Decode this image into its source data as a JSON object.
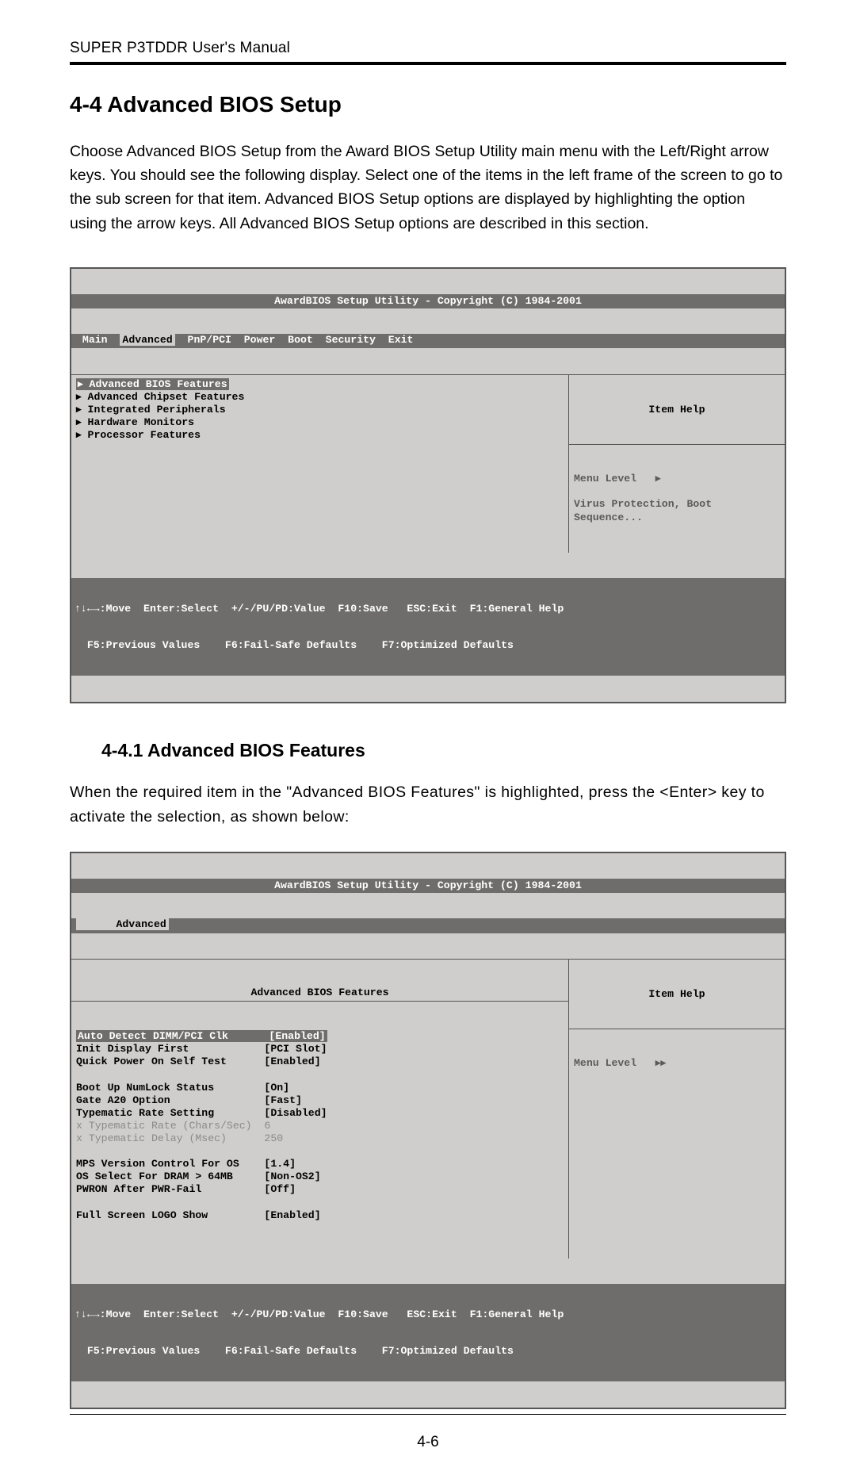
{
  "header": "SUPER P3TDDR User's Manual",
  "section_title": "4-4   Advanced BIOS Setup",
  "paragraph1": " Choose Advanced BIOS Setup from the Award BIOS Setup Utility main menu with the Left/Right arrow keys.    You should see the following display.  Select one of the items in the left frame of the screen to go to the sub screen for that item. Advanced BIOS Setup options are displayed by highlighting the option using the arrow keys. All Advanced BIOS Setup options are described in this section.",
  "subsection_title": "4-4.1     Advanced BIOS Features",
  "paragraph2": "When the required item in the \"Advanced BIOS Features\" is highlighted, press the <Enter> key to activate the selection, as shown below:",
  "page_number": "4-6",
  "bios1": {
    "title": "AwardBIOS Setup Utility - Copyright (C) 1984-2001",
    "tabs": [
      "Main",
      "Advanced",
      "PnP/PCI",
      "Power",
      "Boot",
      "Security",
      "Exit"
    ],
    "active_tab_index": 1,
    "menu_items": [
      "Advanced BIOS Features",
      "Advanced Chipset Features",
      "Integrated Peripherals",
      "Hardware Monitors",
      "Processor Features"
    ],
    "selected_index": 0,
    "help_title": "Item Help",
    "help_lines": [
      "Menu Level   ▸",
      "",
      "Virus Protection, Boot",
      "Sequence..."
    ],
    "footer1": "↑↓←→:Move  Enter:Select  +/-/PU/PD:Value  F10:Save   ESC:Exit  F1:General Help",
    "footer2": "  F5:Previous Values    F6:Fail-Safe Defaults    F7:Optimized Defaults"
  },
  "bios2": {
    "title": "AwardBIOS Setup Utility - Copyright (C) 1984-2001",
    "tabs_line": "      Advanced",
    "pane_title": "Advanced BIOS Features",
    "rows": [
      {
        "label": "Auto Detect DIMM/PCI Clk",
        "value": "[Enabled]",
        "hl": true
      },
      {
        "label": "Init Display First",
        "value": "[PCI Slot]"
      },
      {
        "label": "Quick Power On Self Test",
        "value": "[Enabled]"
      },
      {
        "label": "",
        "value": ""
      },
      {
        "label": "Boot Up NumLock Status",
        "value": "[On]"
      },
      {
        "label": "Gate A20 Option",
        "value": "[Fast]"
      },
      {
        "label": "Typematic Rate Setting",
        "value": "[Disabled]"
      },
      {
        "label": "x Typematic Rate (Chars/Sec)",
        "value": "6",
        "dim": true
      },
      {
        "label": "x Typematic Delay (Msec)",
        "value": "250",
        "dim": true
      },
      {
        "label": "",
        "value": ""
      },
      {
        "label": "MPS Version Control For OS",
        "value": "[1.4]"
      },
      {
        "label": "OS Select For DRAM > 64MB",
        "value": "[Non-OS2]"
      },
      {
        "label": "PWRON After PWR-Fail",
        "value": "[Off]"
      },
      {
        "label": "",
        "value": ""
      },
      {
        "label": "Full Screen LOGO Show",
        "value": "[Enabled]"
      }
    ],
    "help_title": "Item Help",
    "help_lines": [
      "Menu Level   ▸▸"
    ],
    "footer1": "↑↓←→:Move  Enter:Select  +/-/PU/PD:Value  F10:Save   ESC:Exit  F1:General Help",
    "footer2": "  F5:Previous Values    F6:Fail-Safe Defaults    F7:Optimized Defaults"
  }
}
